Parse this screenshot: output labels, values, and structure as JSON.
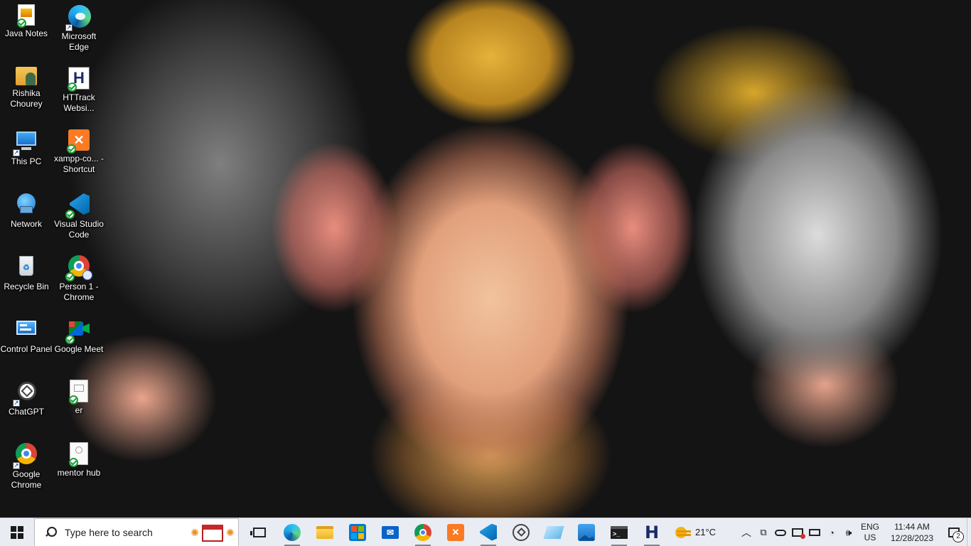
{
  "desktop": {
    "icons": [
      {
        "label": "Java Notes",
        "icon": "document-icon"
      },
      {
        "label": "Microsoft Edge",
        "icon": "edge-icon"
      },
      {
        "label": "Rishika Chourey",
        "icon": "user-folder-icon"
      },
      {
        "label": "HTTrack Websi...",
        "icon": "httrack-icon"
      },
      {
        "label": "This PC",
        "icon": "computer-icon"
      },
      {
        "label": "xampp-co... - Shortcut",
        "icon": "xampp-icon"
      },
      {
        "label": "Network",
        "icon": "network-icon"
      },
      {
        "label": "Visual Studio Code",
        "icon": "vscode-icon"
      },
      {
        "label": "Recycle Bin",
        "icon": "recycle-bin-icon"
      },
      {
        "label": "Person 1 - Chrome",
        "icon": "chrome-profile-icon"
      },
      {
        "label": "Control Panel",
        "icon": "control-panel-icon"
      },
      {
        "label": "Google Meet",
        "icon": "google-meet-icon"
      },
      {
        "label": "ChatGPT",
        "icon": "chatgpt-icon"
      },
      {
        "label": "er",
        "icon": "image-file-icon"
      },
      {
        "label": "Google Chrome",
        "icon": "chrome-icon"
      },
      {
        "label": "mentor hub",
        "icon": "image-file-icon"
      }
    ]
  },
  "taskbar": {
    "search_placeholder": "Type here to search",
    "apps": [
      {
        "name": "task-view",
        "icon": "task-view-icon"
      },
      {
        "name": "edge",
        "icon": "edge-icon"
      },
      {
        "name": "file-explorer",
        "icon": "folder-icon"
      },
      {
        "name": "microsoft-store",
        "icon": "store-icon"
      },
      {
        "name": "mail",
        "icon": "mail-icon"
      },
      {
        "name": "chrome",
        "icon": "chrome-icon"
      },
      {
        "name": "xampp",
        "icon": "xampp-icon"
      },
      {
        "name": "vscode",
        "icon": "vscode-icon"
      },
      {
        "name": "chatgpt",
        "icon": "chatgpt-icon"
      },
      {
        "name": "notepad",
        "icon": "notepad-icon"
      },
      {
        "name": "photos",
        "icon": "photos-icon"
      },
      {
        "name": "terminal",
        "icon": "terminal-icon"
      },
      {
        "name": "httrack",
        "icon": "httrack-icon"
      }
    ],
    "weather": {
      "temp": "21°C"
    },
    "language": {
      "line1": "ENG",
      "line2": "US"
    },
    "clock": {
      "time": "11:44 AM",
      "date": "12/28/2023"
    },
    "notifications": {
      "count": "2"
    }
  },
  "colors": {
    "taskbar_bg": "#e9ecf2",
    "accent_blue": "#0078d4"
  }
}
